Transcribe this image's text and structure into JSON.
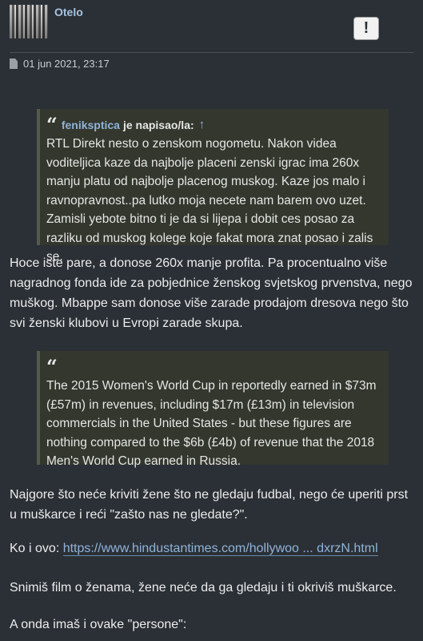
{
  "post": {
    "username": "Otelo",
    "report_label": "!",
    "date": "01 jun 2021, 23:17"
  },
  "quote1": {
    "author": "feniksptica",
    "says": "je napisao/la:",
    "arrow": "↑",
    "text": "RTL Direkt nesto o zenskom nogometu. Nakon videa voditeljica kaze da najbolje placeni zenski igrac ima 260x manju platu od najbolje placenog muskog. Kaze jos malo i ravnopravnost..pa lutko moja necete nam barem ovo uzet. Zamisli yebote bitno ti je da si lijepa i dobit ces posao za razliku od muskog kolege koje fakat mora znat posao i zalis se."
  },
  "paragraph1": "Hoce iste pare, a donose 260x manje profita. Pa procentualno više nagradnog fonda ide za pobjednice ženskog svjetskog prvenstva, nego muškog. Mbappe sam donose više zarade prodajom dresova nego što svi ženski klubovi u Evropi zarade skupa.",
  "quote2": {
    "text": "The 2015 Women's World Cup in reportedly earned in $73m (£57m) in revenues, including $17m (£13m) in television commercials in the United States - but these figures are nothing compared to the $6b (£4b) of revenue that the 2018 Men's World Cup earned in Russia."
  },
  "paragraph2": "Najgore što neće kriviti žene što ne gledaju fudbal, nego će uperiti prst u muškarce i reći \"zašto nas ne gledate?\".",
  "paragraph3": {
    "prefix": "Ko i ovo: ",
    "link_text": "https://www.hindustantimes.com/hollywoo ... dxrzN.html"
  },
  "paragraph4": "Snimiš film o ženama, žene neće da ga gledaju i ti okriviš muškarce.",
  "paragraph5": "A onda imaš i ovake \"persone\":",
  "icons": {
    "quote": "“",
    "doc": "document-icon"
  }
}
